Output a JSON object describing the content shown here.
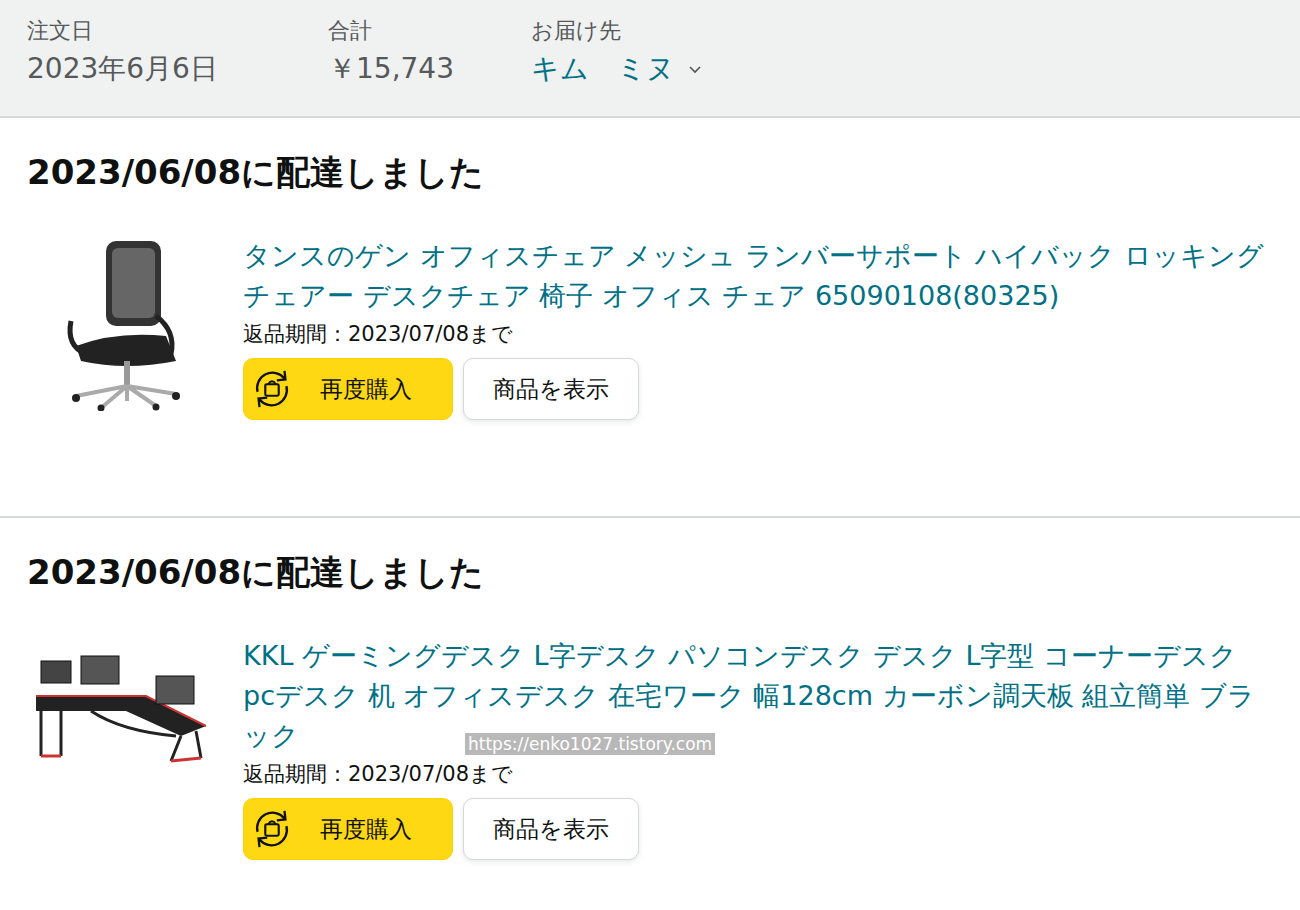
{
  "order": {
    "date_label": "注文日",
    "date": "2023年6月6日",
    "total_label": "合計",
    "total": "￥15,743",
    "ship_label": "お届け先",
    "recipient": "キム　ミヌ"
  },
  "shipments": [
    {
      "status": "2023/06/08に配達しました",
      "product": {
        "kind": "chair",
        "title": "タンスのゲン オフィスチェア メッシュ ランバーサポート ハイバック ロッキングチェアー デスクチェア 椅子 オフィス チェア 65090108(80325)",
        "return_window": "返品期間：2023/07/08まで"
      },
      "buy_again": "再度購入",
      "view": "商品を表示"
    },
    {
      "status": "2023/06/08に配達しました",
      "product": {
        "kind": "desk",
        "title": "KKL ゲーミングデスク L字デスク パソコンデスク デスク L字型 コーナーデスク pcデスク 机 オフィスデスク 在宅ワーク 幅128cm カーボン調天板 組立簡単 ブラック",
        "return_window": "返品期間：2023/07/08まで"
      },
      "buy_again": "再度購入",
      "view": "商品を表示"
    }
  ],
  "watermark": "https://enko1027.tistory.com"
}
